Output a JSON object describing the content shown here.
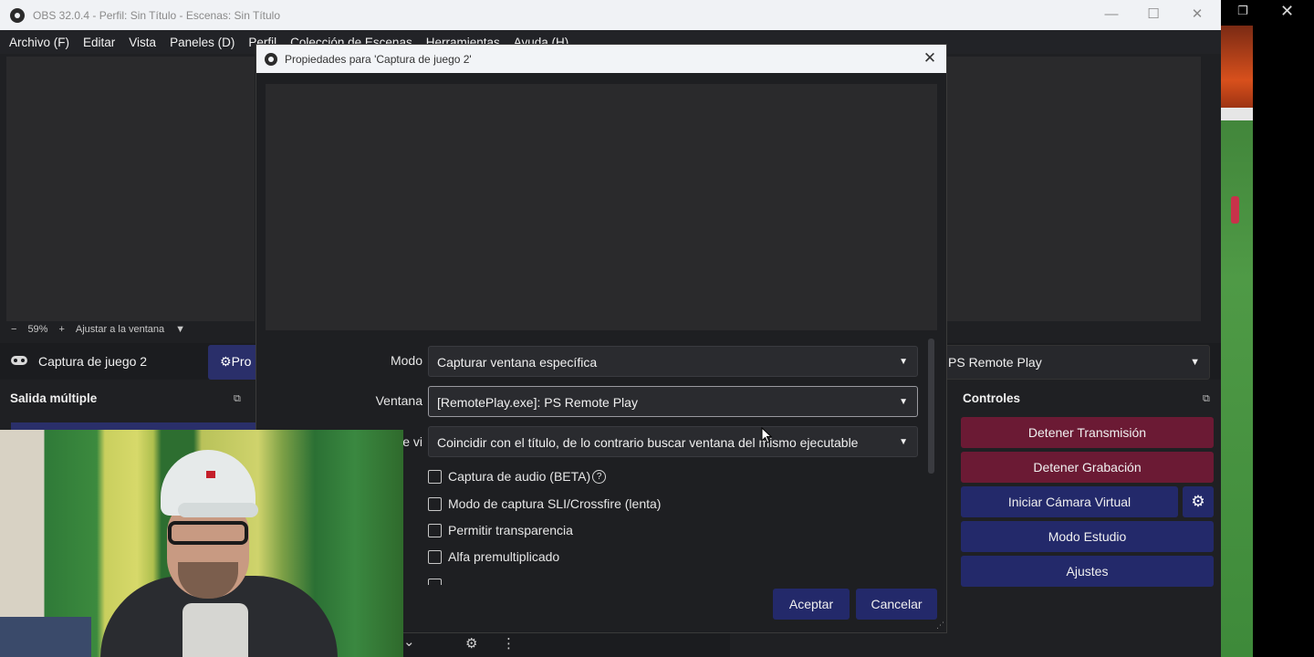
{
  "obs_window": {
    "title": "OBS 32.0.4 - Perfil: Sin Título - Escenas: Sin Título",
    "controls": {
      "minimize": "—",
      "maximize": "☐",
      "close": "✕"
    }
  },
  "menu": [
    "Archivo (F)",
    "Editar",
    "Vista",
    "Paneles (D)",
    "Perfil",
    "Colección de Escenas",
    "Herramientas",
    "Ayuda (H)"
  ],
  "zoom": {
    "minus": "−",
    "value": "59%",
    "plus": "+",
    "fit": "Ajustar a la ventana",
    "caret": "▼"
  },
  "source_bar": {
    "icon": "gamepad-icon",
    "source_name": "Captura de juego 2",
    "properties_button": "Propiedades",
    "properties_visible": "Pro",
    "window_value": "PS Remote Play",
    "arrow": "▼"
  },
  "docks": {
    "output_title": "Salida múltiple",
    "controls_title": "Controles",
    "undock_glyph": "⧉"
  },
  "controls": {
    "stop_stream": "Detener Transmisión",
    "stop_record": "Detener Grabación",
    "virtual_cam": "Iniciar Cámara Virtual",
    "studio_mode": "Modo Estudio",
    "settings": "Ajustes",
    "gear_glyph": "⚙"
  },
  "bottom_tools": {
    "chevron": "⌄",
    "gears": "⚙",
    "more": "⋮"
  },
  "outer_controls": {
    "maximize": "❐",
    "close": "✕"
  },
  "dialog": {
    "title": "Propiedades para 'Captura de juego 2'",
    "close": "✕",
    "fields": {
      "mode_label": "Modo",
      "mode_value": "Capturar ventana específica",
      "window_label": "Ventana",
      "window_value": "[RemotePlay.exe]: PS Remote Play",
      "priority_label_visible": "e vi",
      "priority_value": "Coincidir con el título, de lo contrario buscar ventana del mismo ejecutable"
    },
    "checkboxes": [
      {
        "label": "Captura de audio (BETA)",
        "checked": false,
        "help": "?"
      },
      {
        "label": "Modo de captura SLI/Crossfire (lenta)",
        "checked": false
      },
      {
        "label": "Permitir transparencia",
        "checked": false
      },
      {
        "label": "Alfa premultiplicado",
        "checked": false
      }
    ],
    "buttons": {
      "ok": "Aceptar",
      "cancel": "Cancelar"
    },
    "dropdown_arrow": "▼",
    "grip": "⋰"
  },
  "colors": {
    "obs_bg": "#1f2023",
    "accent_blue": "#23296a",
    "accent_red": "#6b1a34",
    "titlebar_light": "#f0f2f5"
  }
}
